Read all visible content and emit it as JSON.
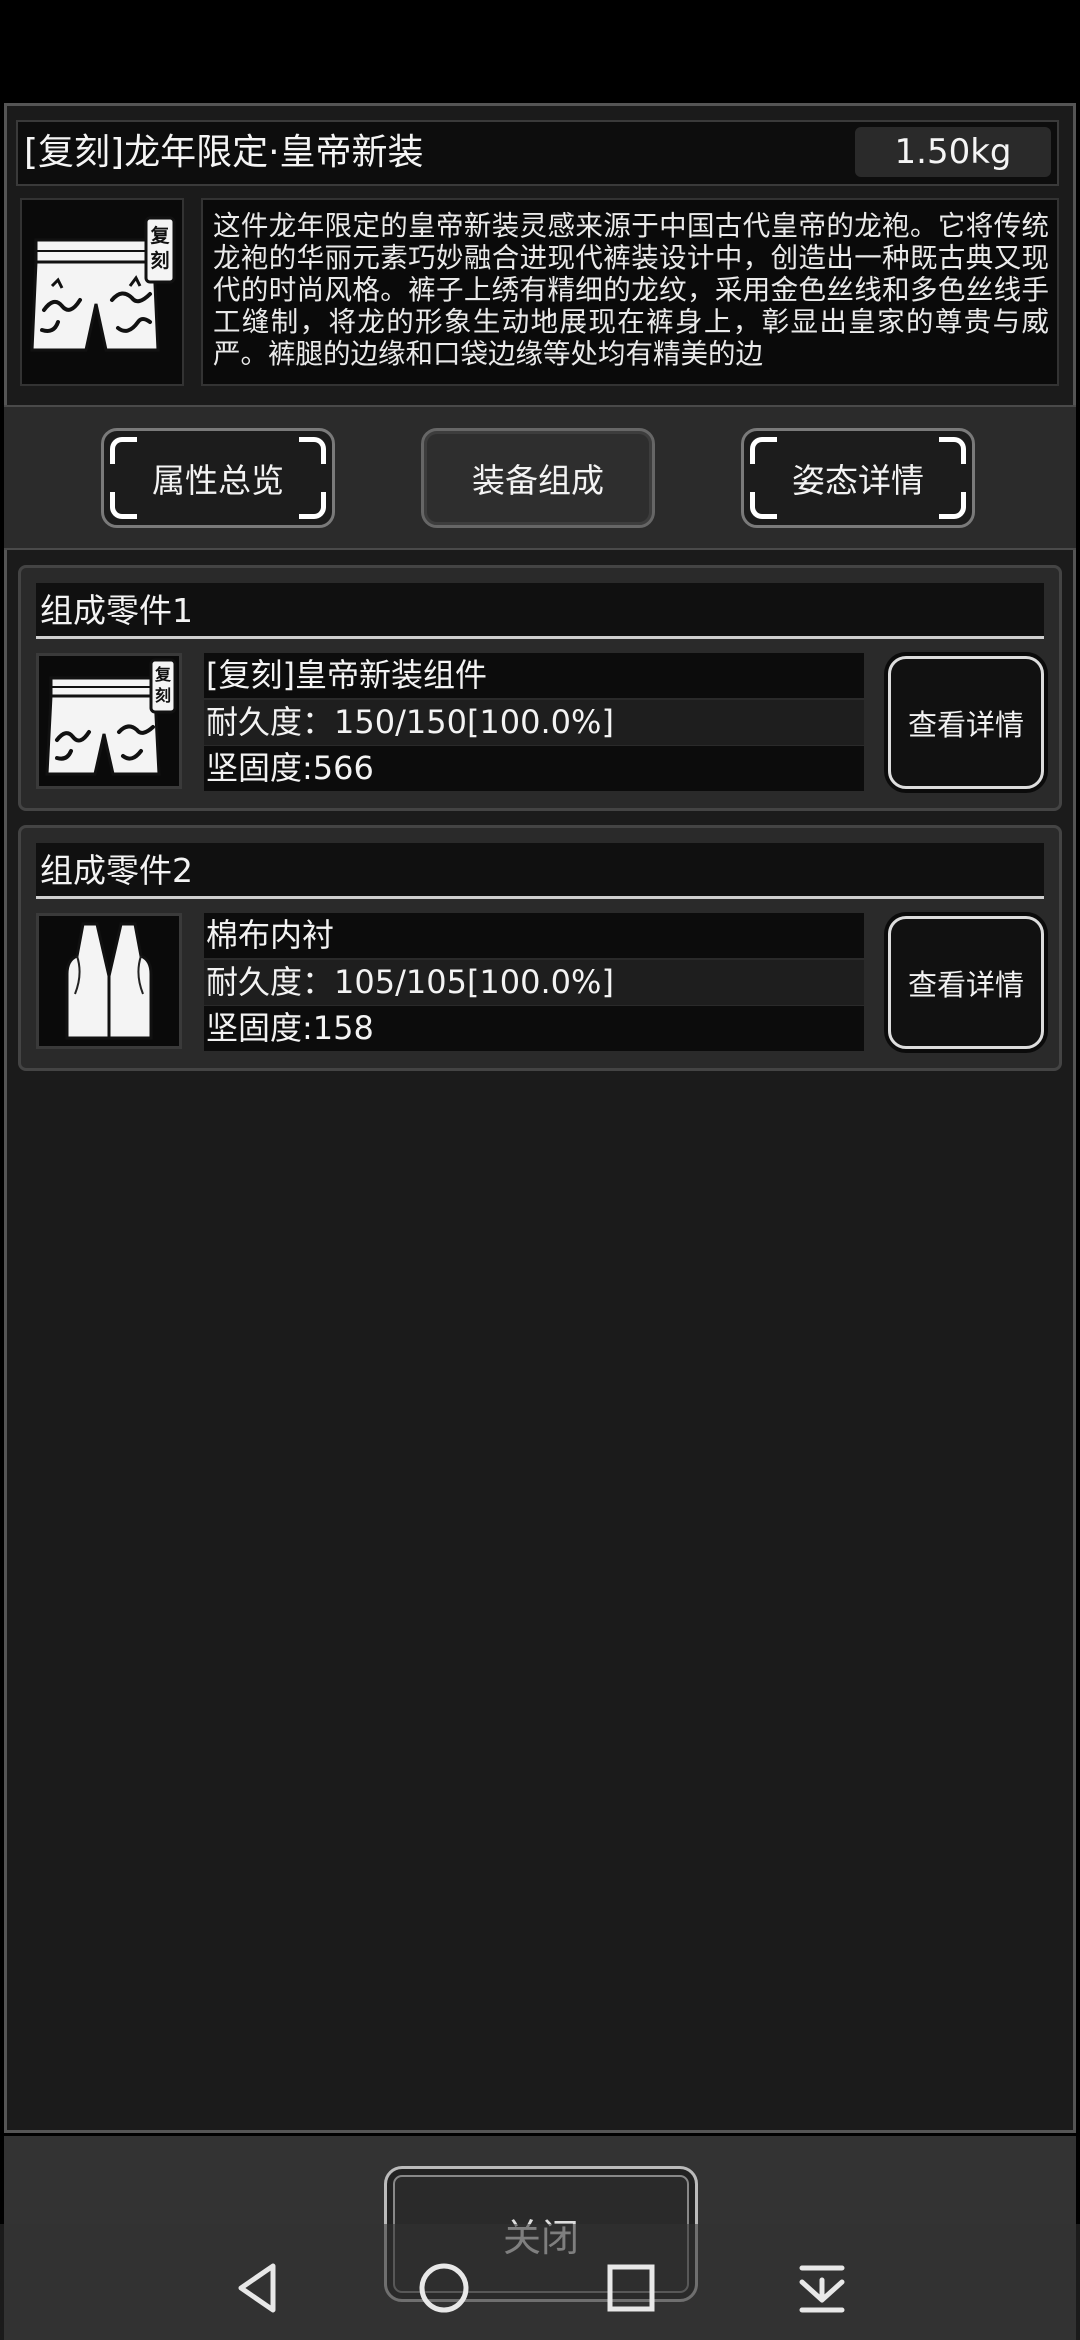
{
  "item": {
    "title": "[复刻]龙年限定·皇帝新装",
    "weight": "1.50kg",
    "badge": "复刻",
    "description": "这件龙年限定的皇帝新装灵感来源于中国古代皇帝的龙袍。它将传统龙袍的华丽元素巧妙融合进现代裤装设计中，创造出一种既古典又现代的时尚风格。裤子上绣有精细的龙纹，采用金色丝线和多色丝线手工缝制，将龙的形象生动地展现在裤身上，彰显出皇家的尊贵与威严。裤腿的边缘和口袋边缘等处均有精美的边"
  },
  "tabs": [
    {
      "label": "属性总览",
      "active": false
    },
    {
      "label": "装备组成",
      "active": true
    },
    {
      "label": "姿态详情",
      "active": false
    }
  ],
  "components": [
    {
      "header": "组成零件1",
      "name": "[复刻]皇帝新装组件",
      "durability": "耐久度：150/150[100.0%]",
      "hardness": "坚固度:566",
      "icon": "shorts-icon",
      "badge": "复刻",
      "button": "查看详情"
    },
    {
      "header": "组成零件2",
      "name": "棉布内衬",
      "durability": "耐久度：105/105[100.0%]",
      "hardness": "坚固度:158",
      "icon": "vest-icon",
      "button": "查看详情"
    }
  ],
  "footer": {
    "close_label": "关闭"
  },
  "nav": {
    "back": "back-icon",
    "home": "home-icon",
    "recents": "recents-icon",
    "extra": "dropdown-icon"
  }
}
